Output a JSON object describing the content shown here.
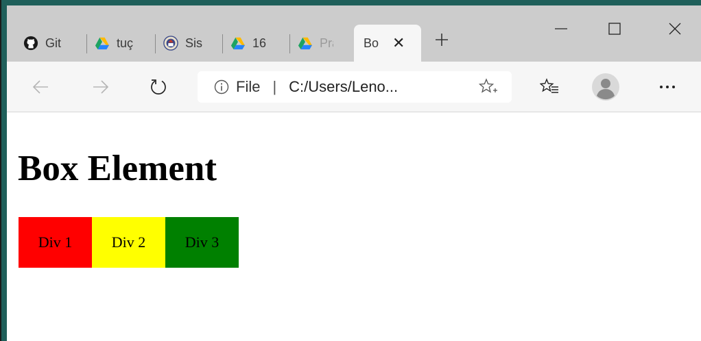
{
  "tabs": [
    {
      "label": "Git",
      "icon": "github-icon"
    },
    {
      "label": "tuç",
      "icon": "google-drive-icon"
    },
    {
      "label": "Sis",
      "icon": "university-seal-icon"
    },
    {
      "label": "16",
      "icon": "google-drive-icon"
    },
    {
      "label": "Pra",
      "icon": "google-drive-icon"
    },
    {
      "label": "Bo",
      "icon": "close-icon",
      "active": true
    }
  ],
  "window_controls": {
    "minimize": "minimize-icon",
    "maximize": "maximize-icon",
    "close": "close-icon"
  },
  "address_bar": {
    "scheme_label": "File",
    "separator": "|",
    "url": "C:/Users/Leno..."
  },
  "page": {
    "title": "Box Element",
    "boxes": [
      {
        "label": "Div 1",
        "color": "#ff0000"
      },
      {
        "label": "Div 2",
        "color": "#ffff00"
      },
      {
        "label": "Div 3",
        "color": "#008000"
      }
    ]
  },
  "colors": {
    "tabstrip": "#cccccc",
    "toolbar": "#f6f6f6",
    "drive_green": "#1ea362",
    "drive_yellow": "#ffba00",
    "drive_blue": "#2684fc"
  }
}
